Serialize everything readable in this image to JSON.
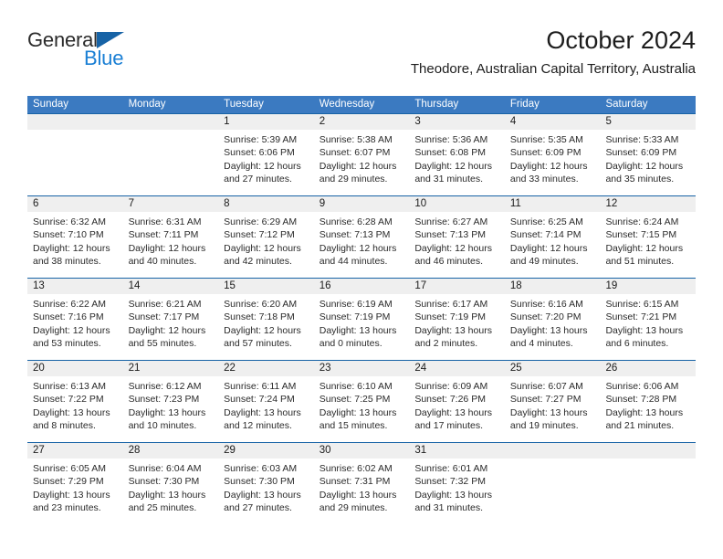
{
  "brand": {
    "name_part1": "General",
    "name_part2": "Blue",
    "triangle_color": "#1763a6",
    "blue_color": "#1a7fd4"
  },
  "header": {
    "title": "October 2024",
    "subtitle": "Theodore, Australian Capital Territory, Australia"
  },
  "theme": {
    "header_blue": "#3b7ac1",
    "separator_blue": "#1763a6",
    "number_band_gray": "#efefef"
  },
  "calendar": {
    "weekdays": [
      "Sunday",
      "Monday",
      "Tuesday",
      "Wednesday",
      "Thursday",
      "Friday",
      "Saturday"
    ],
    "weeks": [
      {
        "days": [
          {
            "num": "",
            "sunrise": "",
            "sunset": "",
            "daylight_1": "",
            "daylight_2": ""
          },
          {
            "num": "",
            "sunrise": "",
            "sunset": "",
            "daylight_1": "",
            "daylight_2": ""
          },
          {
            "num": "1",
            "sunrise": "Sunrise: 5:39 AM",
            "sunset": "Sunset: 6:06 PM",
            "daylight_1": "Daylight: 12 hours",
            "daylight_2": "and 27 minutes."
          },
          {
            "num": "2",
            "sunrise": "Sunrise: 5:38 AM",
            "sunset": "Sunset: 6:07 PM",
            "daylight_1": "Daylight: 12 hours",
            "daylight_2": "and 29 minutes."
          },
          {
            "num": "3",
            "sunrise": "Sunrise: 5:36 AM",
            "sunset": "Sunset: 6:08 PM",
            "daylight_1": "Daylight: 12 hours",
            "daylight_2": "and 31 minutes."
          },
          {
            "num": "4",
            "sunrise": "Sunrise: 5:35 AM",
            "sunset": "Sunset: 6:09 PM",
            "daylight_1": "Daylight: 12 hours",
            "daylight_2": "and 33 minutes."
          },
          {
            "num": "5",
            "sunrise": "Sunrise: 5:33 AM",
            "sunset": "Sunset: 6:09 PM",
            "daylight_1": "Daylight: 12 hours",
            "daylight_2": "and 35 minutes."
          }
        ]
      },
      {
        "days": [
          {
            "num": "6",
            "sunrise": "Sunrise: 6:32 AM",
            "sunset": "Sunset: 7:10 PM",
            "daylight_1": "Daylight: 12 hours",
            "daylight_2": "and 38 minutes."
          },
          {
            "num": "7",
            "sunrise": "Sunrise: 6:31 AM",
            "sunset": "Sunset: 7:11 PM",
            "daylight_1": "Daylight: 12 hours",
            "daylight_2": "and 40 minutes."
          },
          {
            "num": "8",
            "sunrise": "Sunrise: 6:29 AM",
            "sunset": "Sunset: 7:12 PM",
            "daylight_1": "Daylight: 12 hours",
            "daylight_2": "and 42 minutes."
          },
          {
            "num": "9",
            "sunrise": "Sunrise: 6:28 AM",
            "sunset": "Sunset: 7:13 PM",
            "daylight_1": "Daylight: 12 hours",
            "daylight_2": "and 44 minutes."
          },
          {
            "num": "10",
            "sunrise": "Sunrise: 6:27 AM",
            "sunset": "Sunset: 7:13 PM",
            "daylight_1": "Daylight: 12 hours",
            "daylight_2": "and 46 minutes."
          },
          {
            "num": "11",
            "sunrise": "Sunrise: 6:25 AM",
            "sunset": "Sunset: 7:14 PM",
            "daylight_1": "Daylight: 12 hours",
            "daylight_2": "and 49 minutes."
          },
          {
            "num": "12",
            "sunrise": "Sunrise: 6:24 AM",
            "sunset": "Sunset: 7:15 PM",
            "daylight_1": "Daylight: 12 hours",
            "daylight_2": "and 51 minutes."
          }
        ]
      },
      {
        "days": [
          {
            "num": "13",
            "sunrise": "Sunrise: 6:22 AM",
            "sunset": "Sunset: 7:16 PM",
            "daylight_1": "Daylight: 12 hours",
            "daylight_2": "and 53 minutes."
          },
          {
            "num": "14",
            "sunrise": "Sunrise: 6:21 AM",
            "sunset": "Sunset: 7:17 PM",
            "daylight_1": "Daylight: 12 hours",
            "daylight_2": "and 55 minutes."
          },
          {
            "num": "15",
            "sunrise": "Sunrise: 6:20 AM",
            "sunset": "Sunset: 7:18 PM",
            "daylight_1": "Daylight: 12 hours",
            "daylight_2": "and 57 minutes."
          },
          {
            "num": "16",
            "sunrise": "Sunrise: 6:19 AM",
            "sunset": "Sunset: 7:19 PM",
            "daylight_1": "Daylight: 13 hours",
            "daylight_2": "and 0 minutes."
          },
          {
            "num": "17",
            "sunrise": "Sunrise: 6:17 AM",
            "sunset": "Sunset: 7:19 PM",
            "daylight_1": "Daylight: 13 hours",
            "daylight_2": "and 2 minutes."
          },
          {
            "num": "18",
            "sunrise": "Sunrise: 6:16 AM",
            "sunset": "Sunset: 7:20 PM",
            "daylight_1": "Daylight: 13 hours",
            "daylight_2": "and 4 minutes."
          },
          {
            "num": "19",
            "sunrise": "Sunrise: 6:15 AM",
            "sunset": "Sunset: 7:21 PM",
            "daylight_1": "Daylight: 13 hours",
            "daylight_2": "and 6 minutes."
          }
        ]
      },
      {
        "days": [
          {
            "num": "20",
            "sunrise": "Sunrise: 6:13 AM",
            "sunset": "Sunset: 7:22 PM",
            "daylight_1": "Daylight: 13 hours",
            "daylight_2": "and 8 minutes."
          },
          {
            "num": "21",
            "sunrise": "Sunrise: 6:12 AM",
            "sunset": "Sunset: 7:23 PM",
            "daylight_1": "Daylight: 13 hours",
            "daylight_2": "and 10 minutes."
          },
          {
            "num": "22",
            "sunrise": "Sunrise: 6:11 AM",
            "sunset": "Sunset: 7:24 PM",
            "daylight_1": "Daylight: 13 hours",
            "daylight_2": "and 12 minutes."
          },
          {
            "num": "23",
            "sunrise": "Sunrise: 6:10 AM",
            "sunset": "Sunset: 7:25 PM",
            "daylight_1": "Daylight: 13 hours",
            "daylight_2": "and 15 minutes."
          },
          {
            "num": "24",
            "sunrise": "Sunrise: 6:09 AM",
            "sunset": "Sunset: 7:26 PM",
            "daylight_1": "Daylight: 13 hours",
            "daylight_2": "and 17 minutes."
          },
          {
            "num": "25",
            "sunrise": "Sunrise: 6:07 AM",
            "sunset": "Sunset: 7:27 PM",
            "daylight_1": "Daylight: 13 hours",
            "daylight_2": "and 19 minutes."
          },
          {
            "num": "26",
            "sunrise": "Sunrise: 6:06 AM",
            "sunset": "Sunset: 7:28 PM",
            "daylight_1": "Daylight: 13 hours",
            "daylight_2": "and 21 minutes."
          }
        ]
      },
      {
        "days": [
          {
            "num": "27",
            "sunrise": "Sunrise: 6:05 AM",
            "sunset": "Sunset: 7:29 PM",
            "daylight_1": "Daylight: 13 hours",
            "daylight_2": "and 23 minutes."
          },
          {
            "num": "28",
            "sunrise": "Sunrise: 6:04 AM",
            "sunset": "Sunset: 7:30 PM",
            "daylight_1": "Daylight: 13 hours",
            "daylight_2": "and 25 minutes."
          },
          {
            "num": "29",
            "sunrise": "Sunrise: 6:03 AM",
            "sunset": "Sunset: 7:30 PM",
            "daylight_1": "Daylight: 13 hours",
            "daylight_2": "and 27 minutes."
          },
          {
            "num": "30",
            "sunrise": "Sunrise: 6:02 AM",
            "sunset": "Sunset: 7:31 PM",
            "daylight_1": "Daylight: 13 hours",
            "daylight_2": "and 29 minutes."
          },
          {
            "num": "31",
            "sunrise": "Sunrise: 6:01 AM",
            "sunset": "Sunset: 7:32 PM",
            "daylight_1": "Daylight: 13 hours",
            "daylight_2": "and 31 minutes."
          },
          {
            "num": "",
            "sunrise": "",
            "sunset": "",
            "daylight_1": "",
            "daylight_2": ""
          },
          {
            "num": "",
            "sunrise": "",
            "sunset": "",
            "daylight_1": "",
            "daylight_2": ""
          }
        ]
      }
    ]
  }
}
